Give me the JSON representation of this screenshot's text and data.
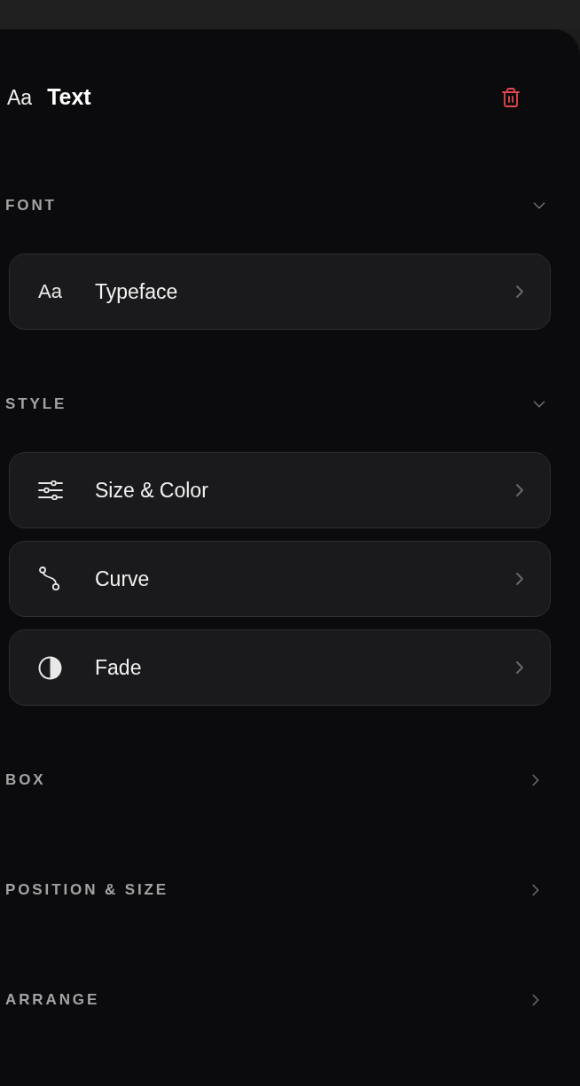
{
  "header": {
    "glyph": "Aa",
    "title": "Text"
  },
  "sections": [
    {
      "title": "FONT",
      "expanded": true,
      "items": [
        {
          "kind": "glyph",
          "glyph": "Aa",
          "label": "Typeface"
        }
      ]
    },
    {
      "title": "STYLE",
      "expanded": true,
      "items": [
        {
          "kind": "sliders",
          "label": "Size & Color"
        },
        {
          "kind": "curve",
          "label": "Curve"
        },
        {
          "kind": "contrast",
          "label": "Fade"
        }
      ]
    },
    {
      "title": "BOX",
      "expanded": false
    },
    {
      "title": "POSITION & SIZE",
      "expanded": false
    },
    {
      "title": "ARRANGE",
      "expanded": false
    }
  ]
}
